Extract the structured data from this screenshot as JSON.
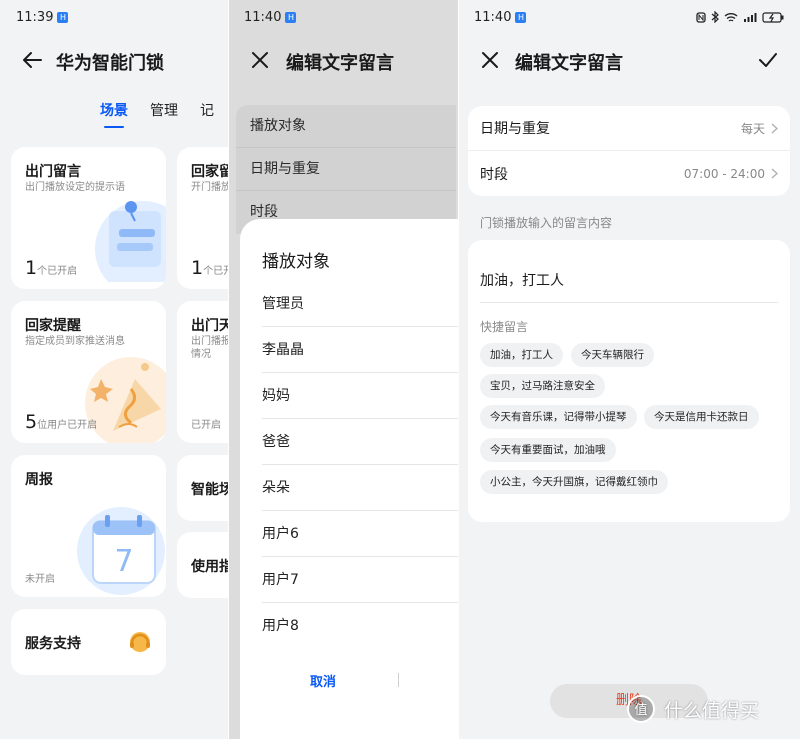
{
  "panel1": {
    "status_time": "11:39",
    "title": "华为智能门锁",
    "tabs": [
      "场景",
      "管理",
      "记"
    ],
    "cards": {
      "out_message": {
        "title": "出门留言",
        "subtitle": "出门播放设定的提示语",
        "count": "1",
        "unit": "个已开启"
      },
      "home_message": {
        "title": "回家留",
        "subtitle": "开门播放",
        "count": "1",
        "unit": "个已开"
      },
      "home_reminder": {
        "title": "回家提醒",
        "subtitle": "指定成员到家推送消息",
        "count": "5",
        "unit": "位用户已开启"
      },
      "out_weather": {
        "title": "出门天",
        "subtitle_1": "出门播报",
        "subtitle_2": "情况",
        "status": "已开启"
      },
      "weekly": {
        "title": "周报",
        "status": "未开启",
        "calendar_digit": "7"
      },
      "smart_scene": {
        "title": "智能场"
      },
      "guide": {
        "title": "使用指"
      },
      "support": {
        "title": "服务支持"
      }
    }
  },
  "panel2": {
    "status_time": "11:40",
    "title": "编辑文字留言",
    "background_rows": [
      "播放对象",
      "日期与重复",
      "时段"
    ],
    "sheet": {
      "title": "播放对象",
      "items": [
        "管理员",
        "李晶晶",
        "妈妈",
        "爸爸",
        "朵朵",
        "用户6",
        "用户7",
        "用户8"
      ],
      "cancel": "取消"
    }
  },
  "panel3": {
    "status_time": "11:40",
    "title": "编辑文字留言",
    "rows": [
      {
        "label": "日期与重复",
        "value": "每天"
      },
      {
        "label": "时段",
        "value": "07:00 - 24:00"
      }
    ],
    "section_label": "门锁播放输入的留言内容",
    "message": "加油，打工人",
    "quick_label": "快捷留言",
    "chips": [
      "加油，打工人",
      "今天车辆限行",
      "宝贝，过马路注意安全",
      "今天有音乐课，记得带小提琴",
      "今天是信用卡还款日",
      "今天有重要面试，加油哦",
      "小公主，今天升国旗，记得戴红领巾"
    ],
    "delete": "删除"
  },
  "watermark": "什么值得买",
  "colors": {
    "accent": "#0a59f7",
    "danger": "#e84026",
    "background": "#f1f3f5"
  }
}
